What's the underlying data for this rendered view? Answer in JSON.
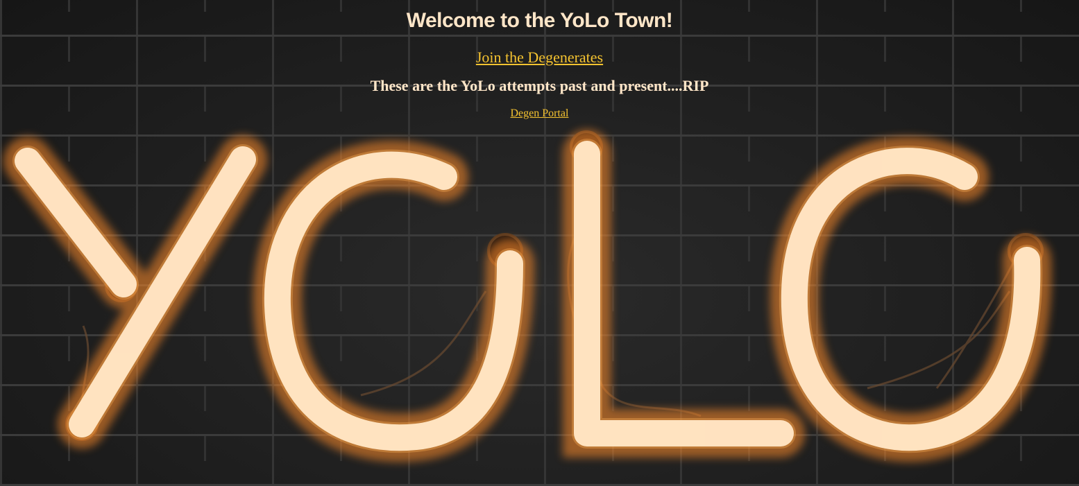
{
  "header": {
    "welcome_title": "Welcome to the YoLo Town!",
    "join_link": "Join the Degenerates",
    "rip_heading": "These are the YoLo attempts past and present....RIP",
    "portal_link": "Degen Portal"
  },
  "background": {
    "neon_text": "YOLO",
    "brick_color": "#1f1f1f",
    "mortar_color": "#3b3b3b",
    "neon_core_color": "#fffdf8",
    "neon_glow_color": "#ff8c2a"
  },
  "colors": {
    "heading": "#ffe6c8",
    "link": "#f5c330"
  }
}
